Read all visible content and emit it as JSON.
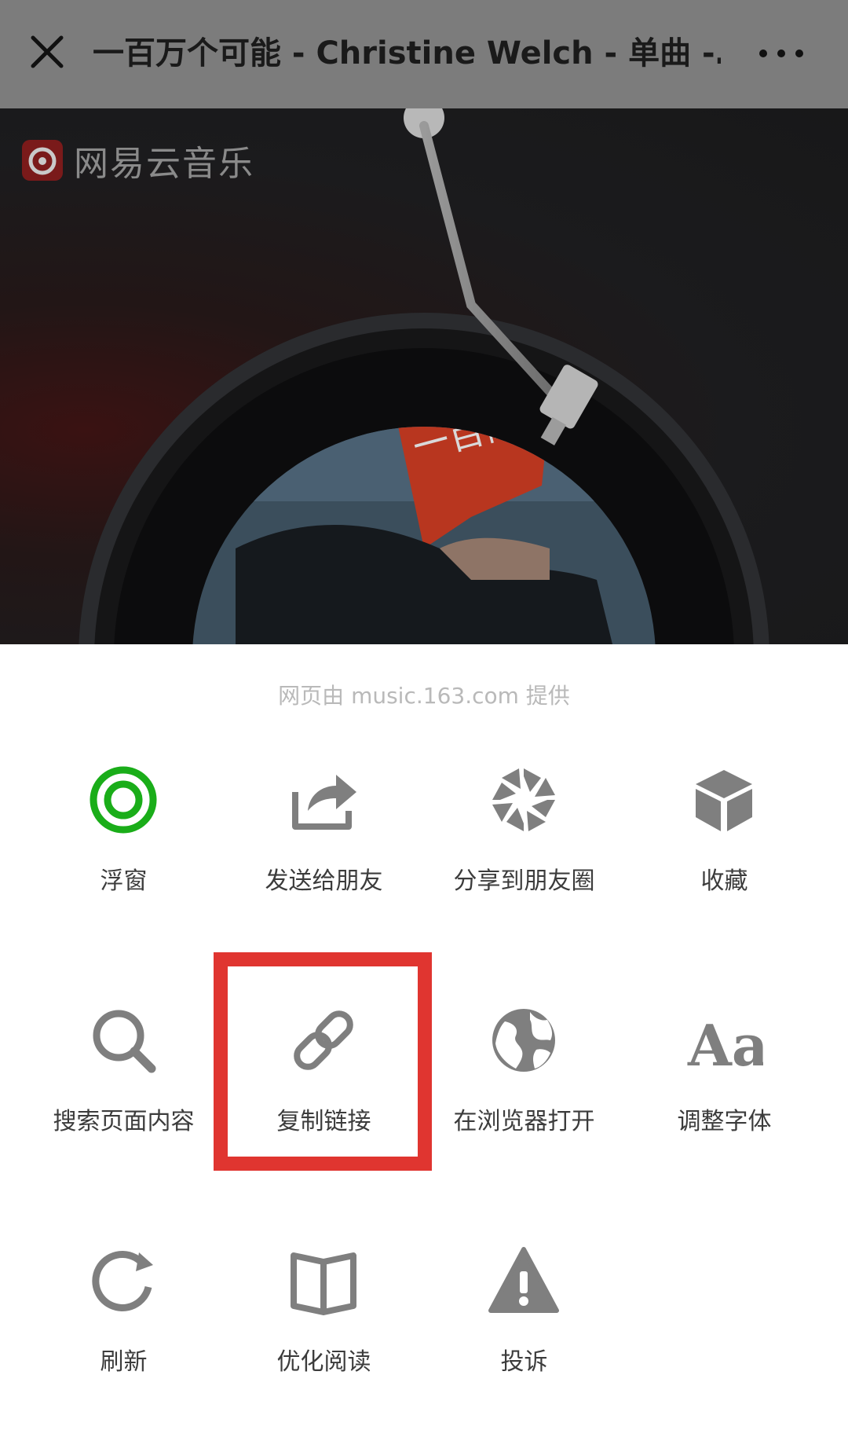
{
  "topbar": {
    "title": "一百万个可能 - Christine Welch - 单曲 -…"
  },
  "webview": {
    "logo_text": "网易云音乐",
    "cover_art_text": "一百萬個可能"
  },
  "sheet": {
    "provider_text": "网页由 music.163.com 提供",
    "items": [
      {
        "label": "浮窗",
        "icon": "floating-window-icon"
      },
      {
        "label": "发送给朋友",
        "icon": "share-arrow-icon"
      },
      {
        "label": "分享到朋友圈",
        "icon": "moments-shutter-icon"
      },
      {
        "label": "收藏",
        "icon": "cube-icon"
      },
      {
        "label": "搜索页面内容",
        "icon": "search-icon"
      },
      {
        "label": "复制链接",
        "icon": "link-icon"
      },
      {
        "label": "在浏览器打开",
        "icon": "globe-icon"
      },
      {
        "label": "调整字体",
        "icon": "font-size-icon"
      },
      {
        "label": "刷新",
        "icon": "refresh-icon"
      },
      {
        "label": "优化阅读",
        "icon": "book-icon"
      },
      {
        "label": "投诉",
        "icon": "warning-icon"
      }
    ]
  },
  "colors": {
    "topbar_bg": "#7c7c7c",
    "accent_green": "#1aad19",
    "icon_gray": "#7f7f7f",
    "highlight_red": "#e03530"
  }
}
